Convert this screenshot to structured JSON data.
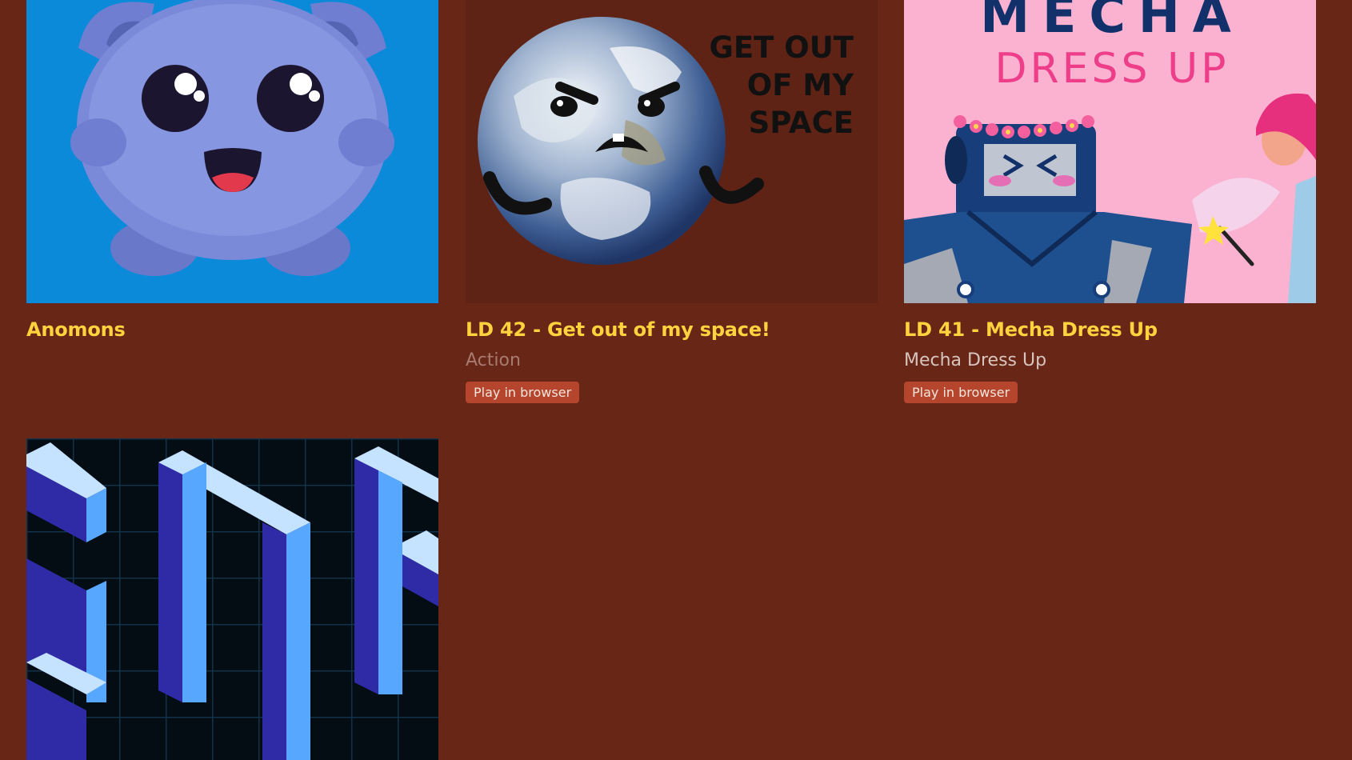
{
  "games": [
    {
      "title": "Anomons",
      "genre": "",
      "badge": ""
    },
    {
      "title": "LD 42 - Get out of my space!",
      "genre": "Action",
      "badge": "Play in browser",
      "thumb_text": [
        "GET OUT",
        "OF MY",
        "SPACE"
      ]
    },
    {
      "title": "LD 41 - Mecha Dress Up",
      "genre": "Mecha Dress Up",
      "badge": "Play in browser",
      "thumb_text": [
        "MECHA",
        "DRESS UP"
      ]
    },
    {
      "title": "",
      "genre": "",
      "badge": ""
    }
  ],
  "colors": {
    "page_background": "#682617",
    "title": "#ffd23e",
    "genre_action": "#a97a6f",
    "genre_other": "#d7c5be",
    "badge_background": "#b5452c",
    "badge_text": "#f4e6de"
  }
}
